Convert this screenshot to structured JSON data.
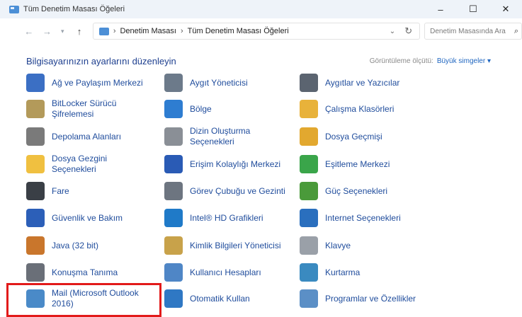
{
  "window": {
    "title": "Tüm Denetim Masası Öğeleri",
    "minimize": "–",
    "maximize": "☐",
    "close": "✕"
  },
  "address": {
    "crumbs": [
      "Denetim Masası",
      "Tüm Denetim Masası Öğeleri"
    ],
    "search_placeholder": "Denetim Masasında Ara"
  },
  "header": {
    "title": "Bilgisayarınızın ayarlarını düzenleyin",
    "view_label": "Görüntüleme ölçütü:",
    "view_value": "Büyük simgeler ▾"
  },
  "items": [
    {
      "label": "Ağ ve Paylaşım Merkezi",
      "icon": "network-icon",
      "color": "#3b6fc4"
    },
    {
      "label": "Aygıt Yöneticisi",
      "icon": "device-manager-icon",
      "color": "#6c7a8a"
    },
    {
      "label": "Aygıtlar ve Yazıcılar",
      "icon": "printer-icon",
      "color": "#5b6470"
    },
    {
      "label": "BitLocker Sürücü Şifrelemesi",
      "icon": "bitlocker-icon",
      "color": "#b39a5a"
    },
    {
      "label": "Bölge",
      "icon": "globe-icon",
      "color": "#2e7dd1"
    },
    {
      "label": "Çalışma Klasörleri",
      "icon": "work-folders-icon",
      "color": "#e8b23a"
    },
    {
      "label": "Depolama Alanları",
      "icon": "storage-icon",
      "color": "#7a7a7a"
    },
    {
      "label": "Dizin Oluşturma Seçenekleri",
      "icon": "indexing-icon",
      "color": "#8a8f96"
    },
    {
      "label": "Dosya Geçmişi",
      "icon": "file-history-icon",
      "color": "#e2a82f"
    },
    {
      "label": "Dosya Gezgini Seçenekleri",
      "icon": "folder-options-icon",
      "color": "#f0c040"
    },
    {
      "label": "Erişim Kolaylığı Merkezi",
      "icon": "ease-of-access-icon",
      "color": "#2a5bb5"
    },
    {
      "label": "Eşitleme Merkezi",
      "icon": "sync-icon",
      "color": "#3aa54a"
    },
    {
      "label": "Fare",
      "icon": "mouse-icon",
      "color": "#3a3f46"
    },
    {
      "label": "Görev Çubuğu ve Gezinti",
      "icon": "taskbar-icon",
      "color": "#6d7580"
    },
    {
      "label": "Güç Seçenekleri",
      "icon": "power-icon",
      "color": "#4a9a3a"
    },
    {
      "label": "Güvenlik ve Bakım",
      "icon": "flag-icon",
      "color": "#2c5fb8"
    },
    {
      "label": "Intel® HD Grafikleri",
      "icon": "intel-graphics-icon",
      "color": "#1f7ac8"
    },
    {
      "label": "Internet Seçenekleri",
      "icon": "internet-options-icon",
      "color": "#2a6fbe"
    },
    {
      "label": "Java (32 bit)",
      "icon": "java-icon",
      "color": "#c9762c"
    },
    {
      "label": "Kimlik Bilgileri Yöneticisi",
      "icon": "credential-icon",
      "color": "#c8a24a"
    },
    {
      "label": "Klavye",
      "icon": "keyboard-icon",
      "color": "#9aa0a8"
    },
    {
      "label": "Konuşma Tanıma",
      "icon": "microphone-icon",
      "color": "#6a6f78"
    },
    {
      "label": "Kullanıcı Hesapları",
      "icon": "users-icon",
      "color": "#4f86c6"
    },
    {
      "label": "Kurtarma",
      "icon": "recovery-icon",
      "color": "#3a8ac0"
    },
    {
      "label": "Mail (Microsoft Outlook 2016)",
      "icon": "mail-icon",
      "color": "#4a8ac8"
    },
    {
      "label": "Otomatik Kullan",
      "icon": "autoplay-icon",
      "color": "#2f78c4"
    },
    {
      "label": "Programlar ve Özellikler",
      "icon": "programs-icon",
      "color": "#5b8fc6"
    }
  ]
}
